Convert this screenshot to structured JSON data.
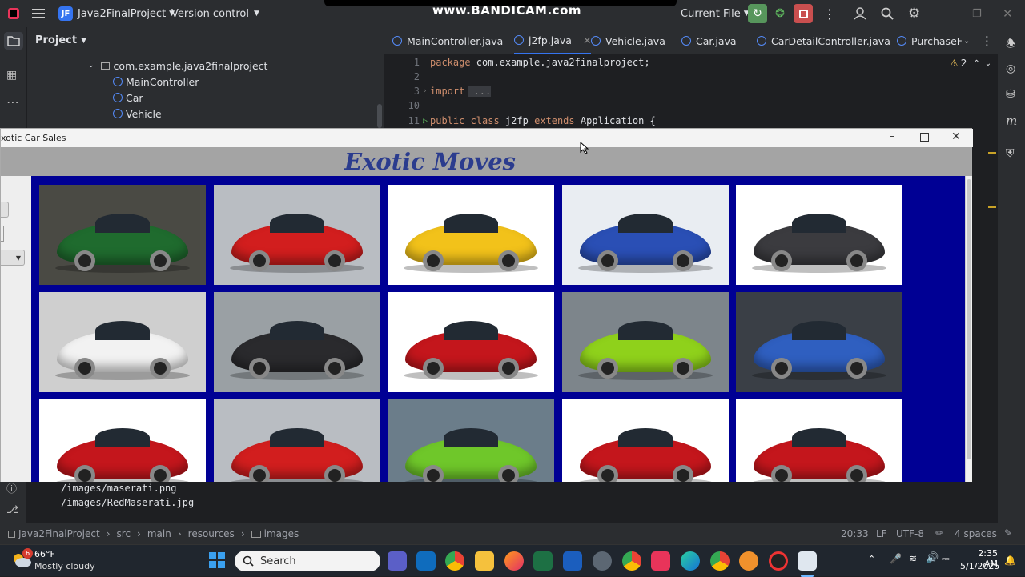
{
  "ide": {
    "project_name": "Java2FinalProject",
    "project_badge": "JF",
    "vcs_label": "Version control",
    "run_config": "Current File",
    "watermark": "www.BANDICAM.com",
    "panel_title": "Project",
    "tree": [
      {
        "label": "com.example.java2finalproject",
        "type": "package"
      },
      {
        "label": "MainController",
        "type": "class"
      },
      {
        "label": "Car",
        "type": "class"
      },
      {
        "label": "Vehicle",
        "type": "class"
      }
    ],
    "tabs": [
      {
        "label": "MainController.java",
        "active": false
      },
      {
        "label": "j2fp.java",
        "active": true
      },
      {
        "label": "Vehicle.java",
        "active": false
      },
      {
        "label": "Car.java",
        "active": false
      },
      {
        "label": "CarDetailController.java",
        "active": false
      },
      {
        "label": "PurchaseF",
        "active": false
      }
    ],
    "warning_count": "2",
    "code": [
      {
        "line": "1",
        "kw": "package",
        "text": " com.example.java2finalproject;"
      },
      {
        "line": "2",
        "kw": "",
        "text": ""
      },
      {
        "line": "3",
        "kw": "import",
        "text": " ..."
      },
      {
        "line": "10",
        "kw": "",
        "text": ""
      },
      {
        "line": "11",
        "kw": "public class",
        "text": " j2fp ",
        "kw2": "extends",
        "text2": " Application {"
      }
    ],
    "console": [
      "/images/maserati.png",
      "/images/RedMaserati.jpg"
    ],
    "status": {
      "breadcrumb": [
        "Java2FinalProject",
        "src",
        "main",
        "resources",
        "images"
      ],
      "position": "20:33",
      "line_sep": "LF",
      "encoding": "UTF-8",
      "indent": "4 spaces"
    }
  },
  "app": {
    "window_title": "xotic Car Sales",
    "header_title": "Exotic Moves",
    "accent_bg": "#000094",
    "header_bg": "#a4a4a4",
    "cars": [
      {
        "name": "green-coupe",
        "color": "#1f6b2e",
        "bg": "#4a4a44"
      },
      {
        "name": "red-ferrari",
        "color": "#d21e1e",
        "bg": "#b9bdc2"
      },
      {
        "name": "yellow-lamborghini",
        "color": "#f2c21a",
        "bg": "#ffffff"
      },
      {
        "name": "blue-mclaren",
        "color": "#2a4fb5",
        "bg": "#e9edf2"
      },
      {
        "name": "grey-maserati",
        "color": "#3b3b3f",
        "bg": "#ffffff"
      },
      {
        "name": "white-ferrari",
        "color": "#f2f2f2",
        "bg": "#cfcfcf"
      },
      {
        "name": "black-ferrari",
        "color": "#2a2a2d",
        "bg": "#9aa0a4"
      },
      {
        "name": "red-maserati",
        "color": "#c4161c",
        "bg": "#ffffff"
      },
      {
        "name": "lime-mclaren",
        "color": "#8fd11b",
        "bg": "#7d858b"
      },
      {
        "name": "blue-maserati",
        "color": "#2f5fc0",
        "bg": "#3a3f46"
      },
      {
        "name": "red-maserati",
        "color": "#c4161c",
        "bg": "#ffffff"
      },
      {
        "name": "red-ferrari",
        "color": "#d21e1e",
        "bg": "#b9bdc2"
      },
      {
        "name": "green-lamborghini",
        "color": "#6fc72a",
        "bg": "#6b7d8a"
      },
      {
        "name": "red-maserati",
        "color": "#c4161c",
        "bg": "#ffffff"
      },
      {
        "name": "red-maserati",
        "color": "#c4161c",
        "bg": "#ffffff"
      }
    ]
  },
  "taskbar": {
    "temp": "66°F",
    "weather": "Mostly cloudy",
    "weather_badge": "6",
    "search_placeholder": "Search",
    "time": "2:35 AM",
    "date": "5/1/2025"
  }
}
